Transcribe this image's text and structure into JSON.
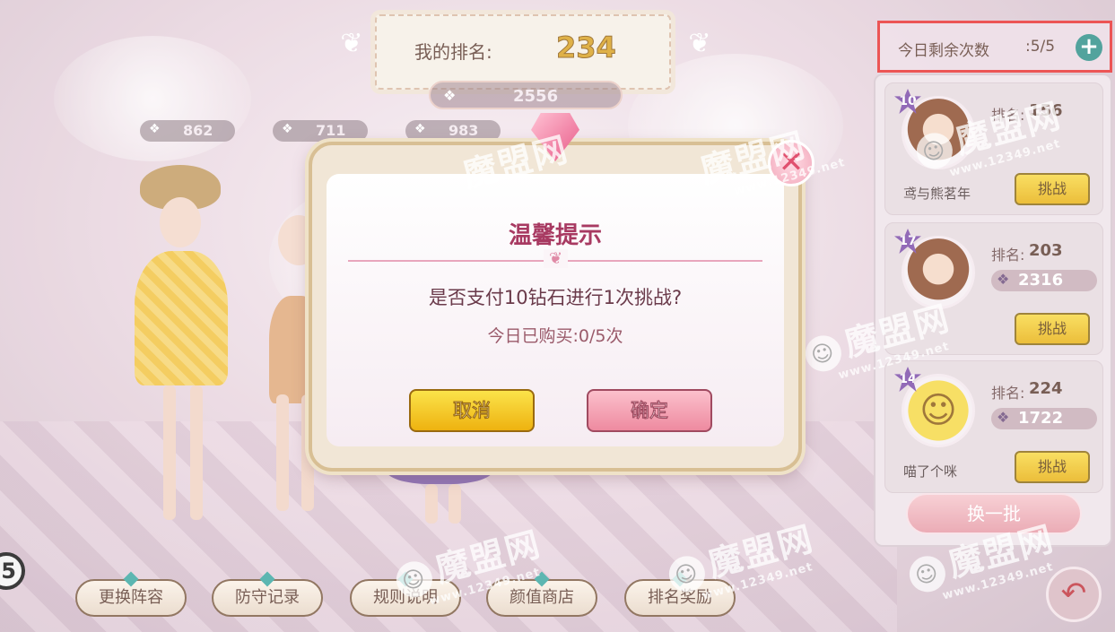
{
  "top_banner": {
    "rank_label": "我的排名:",
    "rank_value": "234",
    "score": "2556"
  },
  "lineup_scores": [
    "862",
    "711",
    "983"
  ],
  "daily_attempts": {
    "label": "今日剩余次数",
    "count": ":5/5",
    "plus_icon": "plus-icon"
  },
  "opponents": [
    {
      "level": "10",
      "rank_label": "排名:",
      "rank_value": "156",
      "score": "",
      "name": "鸢与熊茗年",
      "challenge_label": "挑战",
      "avatar": "girl-portrait"
    },
    {
      "level": "17",
      "rank_label": "排名:",
      "rank_value": "203",
      "score": "2316",
      "name": "",
      "challenge_label": "挑战",
      "avatar": "girl-portrait"
    },
    {
      "level": "14",
      "rank_label": "排名:",
      "rank_value": "224",
      "score": "1722",
      "name": "喵了个咪",
      "challenge_label": "挑战",
      "avatar": "smiley-face"
    }
  ],
  "refresh_label": "换一批",
  "bottom_nav": [
    "更换阵容",
    "防守记录",
    "规则说明",
    "颜值商店",
    "排名奖励"
  ],
  "dialog": {
    "title": "温馨提示",
    "message": "是否支付10钻石进行1次挑战?",
    "sub_message": "今日已购买:0/5次",
    "cancel_label": "取消",
    "confirm_label": "确定",
    "close_icon": "close-icon"
  },
  "edge_badge": "5",
  "watermark": {
    "text": "魔盟网",
    "url": "www.12349.net"
  },
  "colors": {
    "highlight_border": "#e83030",
    "dialog_title": "#a83a62",
    "cancel_button": "#eeb210",
    "confirm_button": "#ee8aa0",
    "plus_button": "#2c8f88"
  }
}
